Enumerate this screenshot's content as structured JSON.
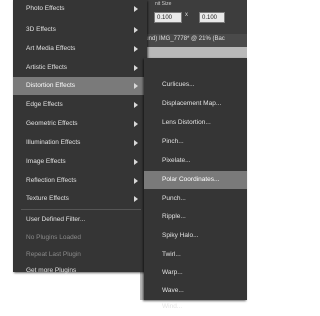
{
  "toolbar": {
    "size_label": "nit Size",
    "width_value": "0.100",
    "link_symbol": "x",
    "height_value": "0.100",
    "tab_text": "ound)   IMG_7778* @ 21% (Bac"
  },
  "main_menu": {
    "items": [
      {
        "label": "Photo Effects"
      },
      {
        "label": "3D Effects"
      },
      {
        "label": "Art Media Effects"
      },
      {
        "label": "Artistic Effects"
      },
      {
        "label": "Distortion Effects"
      },
      {
        "label": "Edge Effects"
      },
      {
        "label": "Geometric Effects"
      },
      {
        "label": "Illumination Effects"
      },
      {
        "label": "Image Effects"
      },
      {
        "label": "Reflection Effects"
      },
      {
        "label": "Texture Effects"
      },
      {
        "label": "User Defined Filter..."
      },
      {
        "label": "No Plugins Loaded"
      },
      {
        "label": "Repeat Last Plugin"
      },
      {
        "label": "Get more Plugins"
      }
    ]
  },
  "submenu": {
    "items": [
      {
        "label": "Curlicues..."
      },
      {
        "label": "Displacement Map..."
      },
      {
        "label": "Lens Distortion..."
      },
      {
        "label": "Pinch..."
      },
      {
        "label": "Pixelate..."
      },
      {
        "label": "Polar Coordinates..."
      },
      {
        "label": "Punch..."
      },
      {
        "label": "Ripple..."
      },
      {
        "label": "Spiky Halo..."
      },
      {
        "label": "Twirl..."
      },
      {
        "label": "Warp..."
      },
      {
        "label": "Wave..."
      },
      {
        "label": "Wind..."
      }
    ]
  },
  "colors": {
    "menu_bg": "#353535",
    "highlight": "#7a7a7a",
    "text": "#e3e3e3",
    "disabled_text": "#8a8a8a"
  }
}
